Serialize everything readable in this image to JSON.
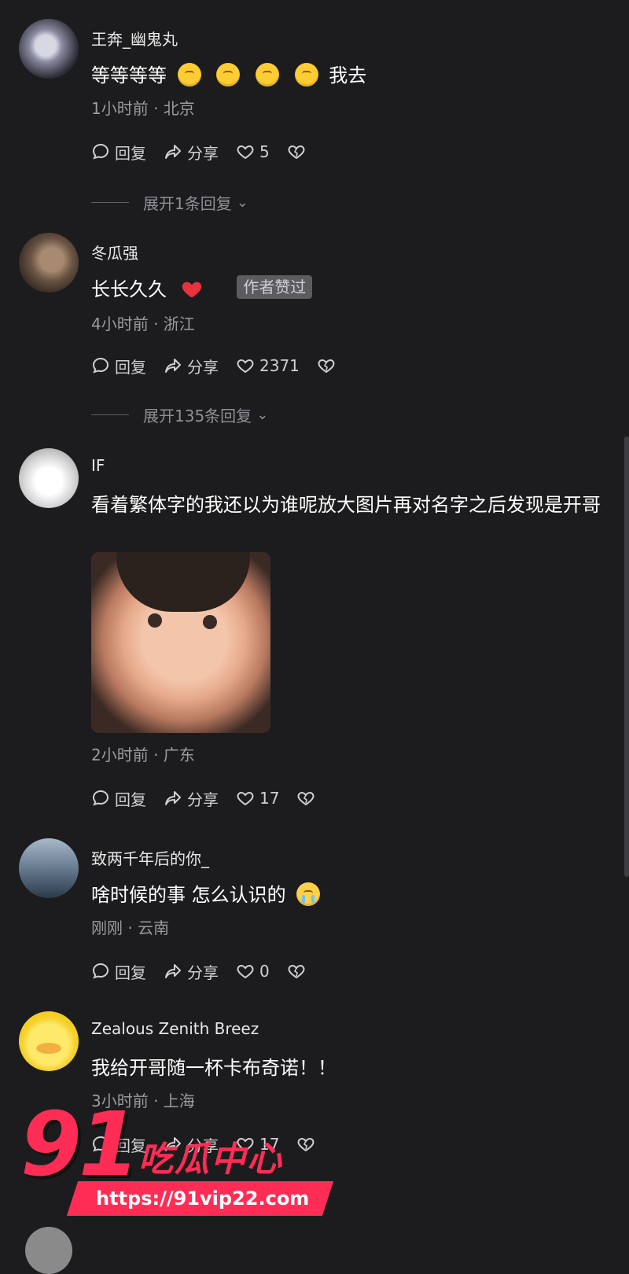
{
  "actions": {
    "reply": "回复",
    "share": "分享"
  },
  "comments": [
    {
      "username": "王奔_幽鬼丸",
      "text_before": "等等等等",
      "text_after": "我去",
      "meta": "1小时前 · 北京",
      "likes": "5",
      "expand": "展开1条回复"
    },
    {
      "username": "冬瓜强",
      "text": "长长久久",
      "badge": "作者赞过",
      "meta": "4小时前 · 浙江",
      "likes": "2371",
      "expand": "展开135条回复"
    },
    {
      "username": "IF",
      "text": "看着繁体字的我还以为谁呢放大图片再对名字之后发现是开哥",
      "meta": "2小时前 · 广东",
      "likes": "17"
    },
    {
      "username": "致两千年后的你_",
      "text": "啥时候的事 怎么认识的",
      "meta": "刚刚 · 云南",
      "likes": "0"
    },
    {
      "username": "Zealous Zenith Breez",
      "text": "我给开哥随一杯卡布奇诺！！",
      "meta": "3小时前 · 上海",
      "likes": "17"
    }
  ],
  "watermark": {
    "number": "91",
    "title": "吃瓜中心",
    "url": "https://91vip22.com"
  }
}
